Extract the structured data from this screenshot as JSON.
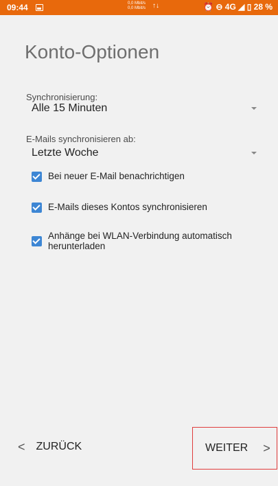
{
  "statusbar": {
    "time": "09:44",
    "net_up": "0,0 Mbit/s",
    "net_down": "0,0 Mbit/s",
    "right": "⏰ ⊖ 4G ◢ ▯ 28 %"
  },
  "page": {
    "title": "Konto-Optionen"
  },
  "sync": {
    "label": "Synchronisierung:",
    "value": "Alle 15 Minuten"
  },
  "sync_from": {
    "label": "E-Mails synchronisieren ab:",
    "value": "Letzte Woche"
  },
  "checkboxes": [
    {
      "label": "Bei neuer E-Mail benachrichtigen",
      "checked": true
    },
    {
      "label": "E-Mails dieses Kontos synchronisieren",
      "checked": true
    },
    {
      "label": "Anhänge bei WLAN-Verbindung automatisch herunterladen",
      "checked": true
    }
  ],
  "nav": {
    "back_label": "ZURÜCK",
    "next_label": "WEITER"
  },
  "colors": {
    "statusbar": "#e8690c",
    "checkbox": "#3d86d4",
    "highlight": "#e03c3c"
  }
}
